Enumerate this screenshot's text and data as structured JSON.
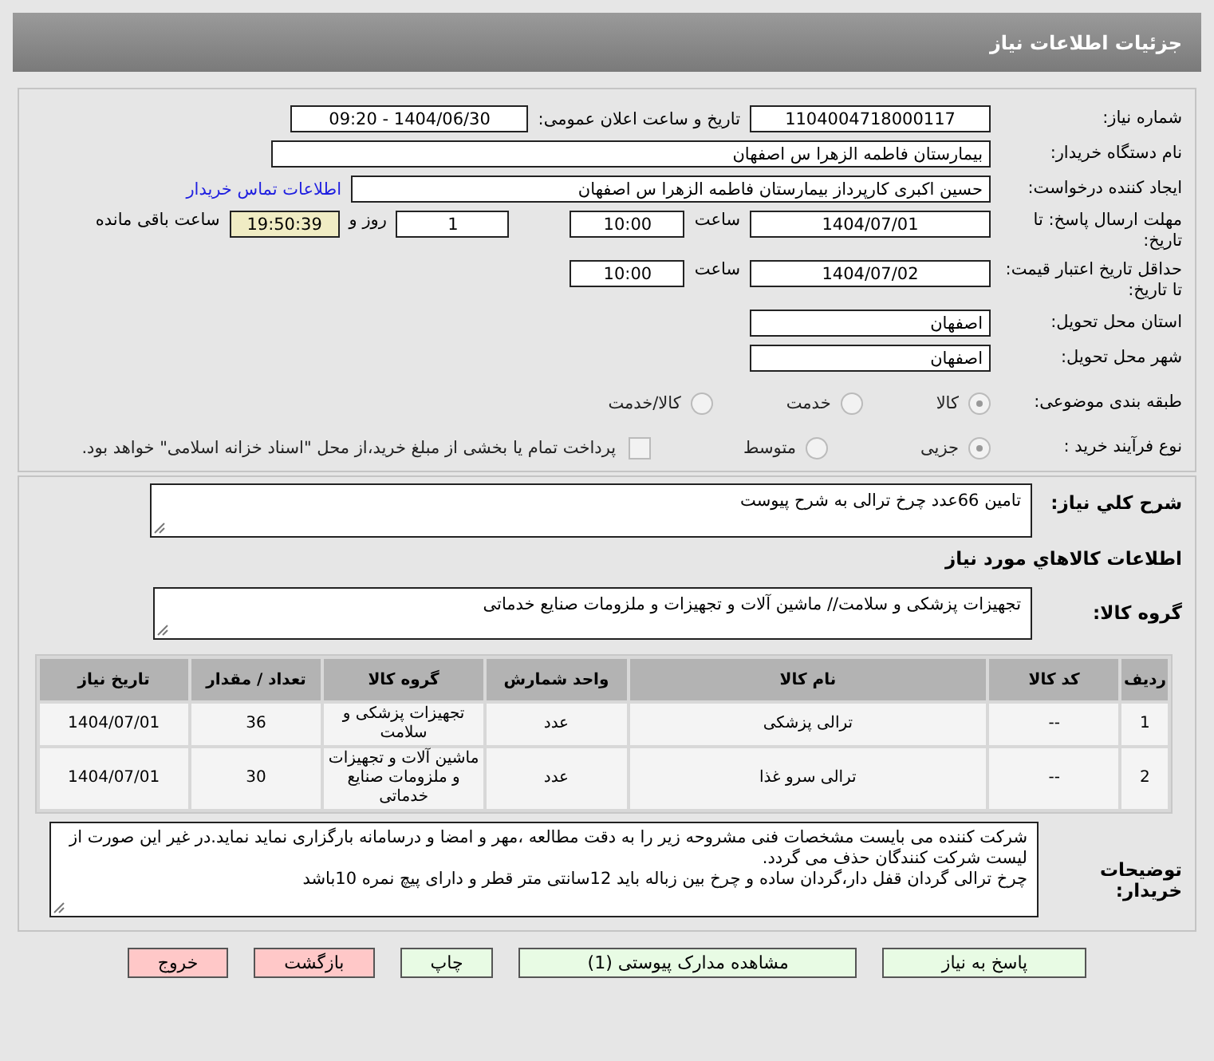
{
  "header": {
    "title": "جزئیات اطلاعات نیاز"
  },
  "form": {
    "need_number": {
      "label": "شماره نیاز:",
      "value": "1104004718000117"
    },
    "announce": {
      "label": "تاریخ و ساعت اعلان عمومی:",
      "value": "1404/06/30 - 09:20"
    },
    "buyer": {
      "label": "نام دستگاه خریدار:",
      "value": "بیمارستان فاطمه الزهرا س  اصفهان"
    },
    "requester": {
      "label": "ایجاد کننده درخواست:",
      "value": "حسین اکبری کارپرداز بیمارستان فاطمه الزهرا س  اصفهان",
      "link": "اطلاعات تماس خریدار"
    },
    "reply_deadline": {
      "label": "مهلت ارسال پاسخ: تا تاریخ:",
      "date": "1404/07/01",
      "time_label": "ساعت",
      "time": "10:00",
      "days": "1",
      "days_label": "روز و",
      "remaining": "19:50:39",
      "remaining_label": "ساعت باقی مانده"
    },
    "price_validity": {
      "label": "حداقل تاریخ اعتبار قیمت: تا تاریخ:",
      "date": "1404/07/02",
      "time_label": "ساعت",
      "time": "10:00"
    },
    "province": {
      "label": "استان محل تحویل:",
      "value": "اصفهان"
    },
    "city": {
      "label": "شهر محل تحویل:",
      "value": "اصفهان"
    },
    "category": {
      "label": "طبقه بندی موضوعی:",
      "options": [
        {
          "label": "کالا",
          "selected": true
        },
        {
          "label": "خدمت",
          "selected": false
        },
        {
          "label": "کالا/خدمت",
          "selected": false
        }
      ]
    },
    "purchase_type": {
      "label": "نوع فرآیند خرید :",
      "options": [
        {
          "label": "جزیی",
          "selected": true
        },
        {
          "label": "متوسط",
          "selected": false
        }
      ],
      "payment": {
        "text": "پرداخت تمام یا بخشی از مبلغ خرید،از محل \"اسناد خزانه اسلامی\" خواهد بود.",
        "checked": false
      }
    }
  },
  "summary": {
    "label": "شرح کلي نياز:",
    "value": "تامین 66عدد چرخ ترالی به شرح پیوست"
  },
  "goods": {
    "title": "اطلاعات کالاهاي مورد نياز",
    "group_label": "گروه کالا:",
    "group_value": "تجهیزات پزشکی و سلامت// ماشین آلات و تجهیزات و ملزومات صنایع خدماتی",
    "columns": [
      "ردیف",
      "کد کالا",
      "نام کالا",
      "واحد شمارش",
      "گروه کالا",
      "تعداد / مقدار",
      "تاریخ نیاز"
    ],
    "rows": [
      [
        "1",
        "--",
        "ترالی پزشکی",
        "عدد",
        "تجهیزات پزشکی و سلامت",
        "36",
        "1404/07/01"
      ],
      [
        "2",
        "--",
        "ترالی سرو غذا",
        "عدد",
        "ماشین آلات و تجهیزات و ملزومات صنایع خدماتی",
        "30",
        "1404/07/01"
      ]
    ]
  },
  "notes": {
    "label": "توضیحات خریدار:",
    "value": "شرکت کننده می بایست مشخصات فنی مشروحه زیر را به دقت مطالعه ،مهر و امضا و درسامانه بارگزاری نماید نماید.در غیر این صورت از لیست شرکت کنندگان حذف می گردد.\nچرخ ترالی گردان قفل دار،گردان ساده و چرخ بین زباله باید 12سانتی متر قطر و دارای پیچ نمره 10باشد"
  },
  "buttons": [
    {
      "label": "پاسخ به نیاز",
      "kind": "action"
    },
    {
      "label": "مشاهده مدارک پیوستی (1)",
      "kind": "action"
    },
    {
      "label": "چاپ",
      "kind": "action"
    },
    {
      "label": "بازگشت",
      "kind": "exit"
    },
    {
      "label": "خروج",
      "kind": "exit"
    }
  ]
}
